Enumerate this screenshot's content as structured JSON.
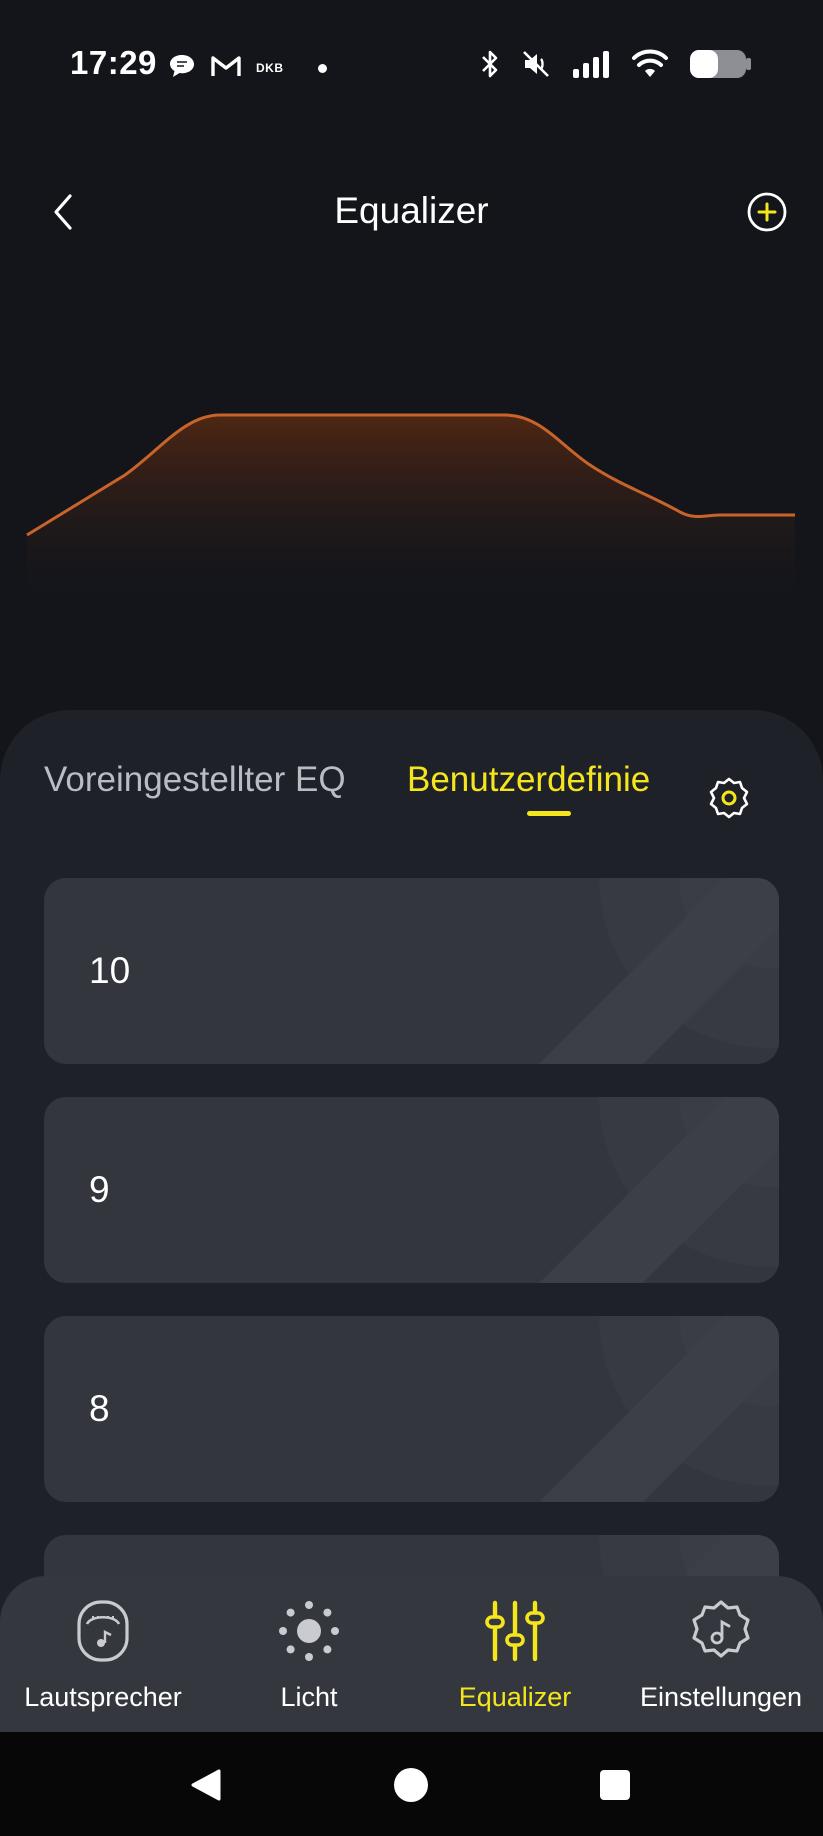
{
  "status_bar": {
    "time": "17:29",
    "left_icons": [
      "chat-bubble-icon",
      "gmail-icon",
      "dkb-icon",
      "notification-dot-icon"
    ],
    "dkb_text": "DKB",
    "right_icons": [
      "bluetooth-icon",
      "mute-icon",
      "signal-icon",
      "wifi-icon",
      "battery-icon"
    ]
  },
  "header": {
    "title": "Equalizer",
    "back_icon": "chevron-left-icon",
    "add_icon": "plus-circle-icon"
  },
  "eq_curve": {
    "color": "#c8642a",
    "fill_color": "#5a2a12"
  },
  "tabs": [
    {
      "label": "Voreingestellter EQ",
      "active": false
    },
    {
      "label": "Benutzerdefinie",
      "active": true
    }
  ],
  "tab_settings_icon": "gear-icon",
  "presets": [
    {
      "label": "10"
    },
    {
      "label": "9"
    },
    {
      "label": "8"
    },
    {
      "label": ""
    }
  ],
  "bottom_nav": [
    {
      "label": "Lautsprecher",
      "icon": "speaker-icon",
      "active": false
    },
    {
      "label": "Licht",
      "icon": "sun-icon",
      "active": false
    },
    {
      "label": "Equalizer",
      "icon": "sliders-icon",
      "active": true
    },
    {
      "label": "Einstellungen",
      "icon": "gear-music-icon",
      "active": false
    }
  ],
  "system_nav": [
    "back-triangle-icon",
    "home-circle-icon",
    "recents-square-icon"
  ],
  "colors": {
    "background": "#13151b",
    "panel": "#1e2127",
    "card": "#33363c",
    "accent": "#f5e51d",
    "nav_bar": "#34373d"
  }
}
